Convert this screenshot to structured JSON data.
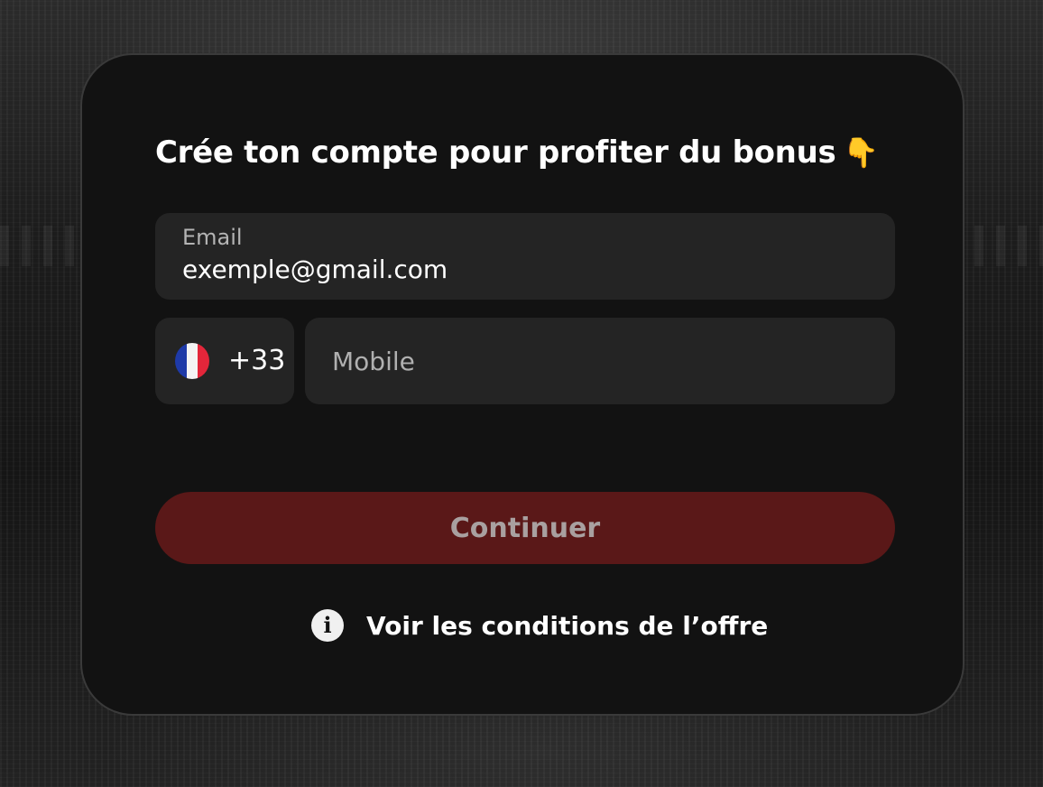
{
  "signup": {
    "title": "Crée ton compte pour profiter du bonus",
    "title_emoji": "👇",
    "email": {
      "label": "Email",
      "value": "exemple@gmail.com"
    },
    "phone": {
      "country_icon": "france-flag-icon",
      "dial_code": "+33",
      "placeholder": "Mobile"
    },
    "continue_label": "Continuer",
    "offer_link": {
      "icon": "info-icon",
      "label": "Voir les conditions de l’offre"
    }
  },
  "colors": {
    "card_background": "#121212",
    "field_background": "#242424",
    "button_background": "#5a1818",
    "button_text": "#a9a0a0",
    "text_primary": "#ffffff",
    "text_muted": "#b4b4b4"
  }
}
